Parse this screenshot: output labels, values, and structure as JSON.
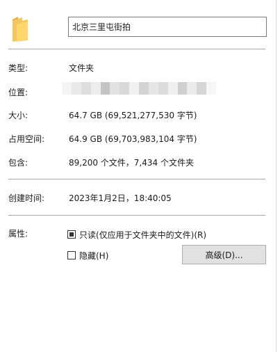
{
  "general": {
    "name_value": "北京三里屯街拍",
    "type_label": "类型:",
    "type_value": "文件夹",
    "location_label": "位置:",
    "location_redaction_colors": [
      "#f4f4f4",
      "#e9e9e9",
      "#dedede",
      "#ececec",
      "#c4c4c4",
      "#e2e2e2",
      "#d9d9d9",
      "#f1f1f1",
      "#d3d3d3",
      "#e6e6e6",
      "#dcdcdc",
      "#efefef",
      "#cfcfcf",
      "#eaeaea",
      "#d6d6d6",
      "#f7f7f7"
    ],
    "size_label": "大小:",
    "size_value": "64.7 GB (69,521,277,530 字节)",
    "disk_size_label": "占用空间:",
    "disk_size_value": "64.9 GB (69,703,983,104 字节)",
    "contains_label": "包含:",
    "contains_value": "89,200 个文件，7,434 个文件夹",
    "created_label": "创建时间:",
    "created_value": "2023年1月2日，18:40:05",
    "attributes_label": "属性:",
    "readonly_label": "只读(仅应用于文件夹中的文件)(R)",
    "readonly_checked": true,
    "hidden_label": "隐藏(H)",
    "hidden_checked": false,
    "advanced_button": "高级(D)..."
  }
}
